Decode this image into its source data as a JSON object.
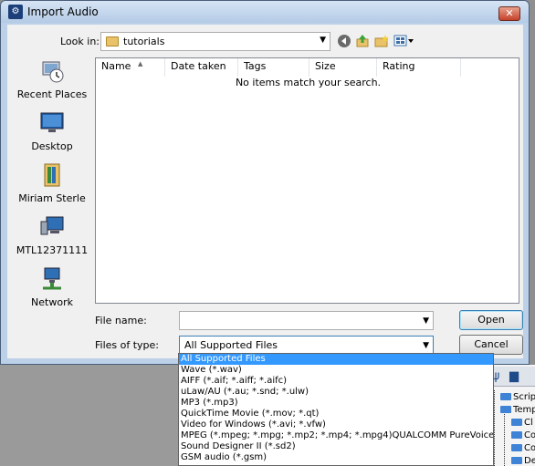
{
  "window": {
    "title": "Import Audio",
    "app_icon": "gear-icon",
    "close_label": "✕"
  },
  "lookin": {
    "label": "Look in:",
    "value": "tutorials"
  },
  "nav": {
    "back_icon": "back-icon",
    "up_icon": "up-folder-icon",
    "new_folder_icon": "new-folder-icon",
    "views_icon": "views-menu-icon"
  },
  "places": [
    {
      "label": "Recent Places",
      "icon": "recent-places-icon"
    },
    {
      "label": "Desktop",
      "icon": "desktop-icon"
    },
    {
      "label": "Miriam Sterle",
      "icon": "user-folder-icon"
    },
    {
      "label": "MTL12371111",
      "icon": "computer-icon"
    },
    {
      "label": "Network",
      "icon": "network-icon"
    }
  ],
  "filelist": {
    "columns": [
      "Name",
      "Date taken",
      "Tags",
      "Size",
      "Rating"
    ],
    "empty_message": "No items match your search."
  },
  "form": {
    "filename_label": "File name:",
    "filename_value": "",
    "filetype_label": "Files of type:",
    "filetype_value": "All Supported Files"
  },
  "buttons": {
    "open": "Open",
    "cancel": "Cancel"
  },
  "filetype_options": [
    "All Supported Files",
    "Wave (*.wav)",
    "AIFF (*.aif; *.aiff; *.aifc)",
    "uLaw/AU (*.au; *.snd; *.ulw)",
    "MP3 (*.mp3)",
    "QuickTime Movie (*.mov; *.qt)",
    "Video for Windows (*.avi; *.vfw)",
    "MPEG (*.mpeg; *.mpg; *.mp2; *.mp4; *.mpg4)QUALCOMM PureVoice (*.qcp)",
    "Sound Designer II (*.sd2)",
    "GSM audio (*.gsm)"
  ],
  "background_tree": [
    "Script",
    "Temp",
    "Cl",
    "Co",
    "Co",
    "De"
  ],
  "colors": {
    "selection": "#3399ff",
    "folder": "#e9c26a",
    "title_gradient_top": "#d6e4f4"
  }
}
